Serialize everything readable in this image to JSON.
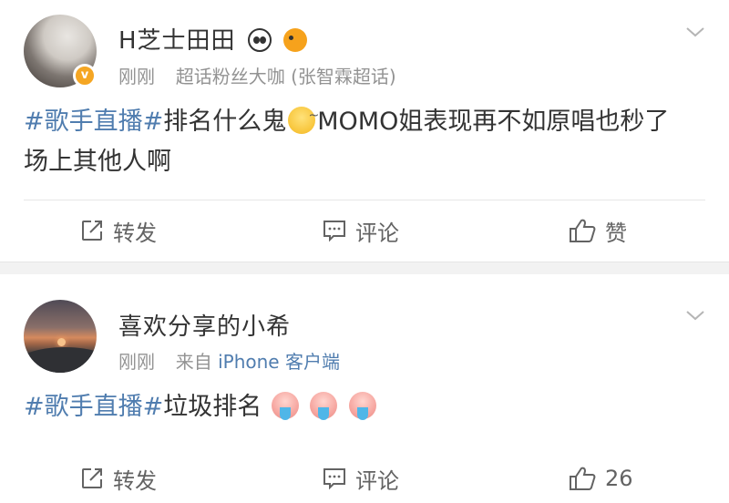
{
  "posts": [
    {
      "username": "H芝士田田",
      "meta_time": "刚刚",
      "meta_source": "超话粉丝大咖 (张智霖超话)",
      "content": {
        "hashtag": "#歌手直播#",
        "text_before_emoji": "排名什么鬼",
        "text_after_emoji": "MOMO姐表现再不如原唱也秒了场上其他人啊"
      },
      "actions": {
        "repost": "转发",
        "comment": "评论",
        "like": "赞"
      }
    },
    {
      "username": "喜欢分享的小希",
      "meta_time": "刚刚",
      "meta_from": "来自",
      "meta_device": "iPhone 客户端",
      "content": {
        "hashtag": "#歌手直播#",
        "text": "垃圾排名"
      },
      "actions": {
        "repost": "转发",
        "comment": "评论",
        "like": "26"
      }
    }
  ],
  "colors": {
    "link": "#507daf",
    "meta": "#939393",
    "text": "#333333",
    "badge": "#f5a623"
  },
  "icons": [
    "panda-emoji-icon",
    "goldfish-emoji-icon",
    "verified-badge-icon",
    "chevron-down-icon",
    "repost-icon",
    "comment-icon",
    "like-icon",
    "sweat-face-emoji-icon",
    "vomit-face-emoji-icon"
  ]
}
